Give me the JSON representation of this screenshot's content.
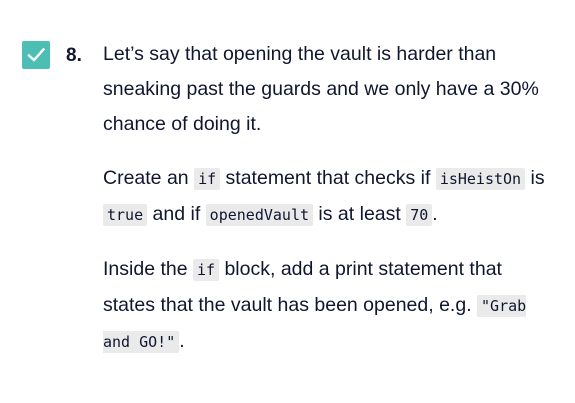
{
  "task": {
    "number": "8.",
    "completed": true,
    "check_color": "#4dbeb4",
    "icon": "checkmark-icon",
    "paragraphs": {
      "p1": "Let’s say that opening the vault is harder than sneaking past the guards and we only have a 30% chance of doing it.",
      "p2": {
        "t1": "Create an ",
        "c1": "if",
        "t2": " statement that checks if ",
        "c2": "isHeistOn",
        "t3": " is ",
        "c3": "true",
        "t4": " and if ",
        "c4": "openedVault",
        "t5": " is at least ",
        "c5": "70",
        "t6": "."
      },
      "p3": {
        "t1": "Inside the ",
        "c1": "if",
        "t2": " block, add a print statement that states that the vault has been opened, e.g. ",
        "c2": "\"Grab and GO!\"",
        "t3": "."
      }
    }
  }
}
